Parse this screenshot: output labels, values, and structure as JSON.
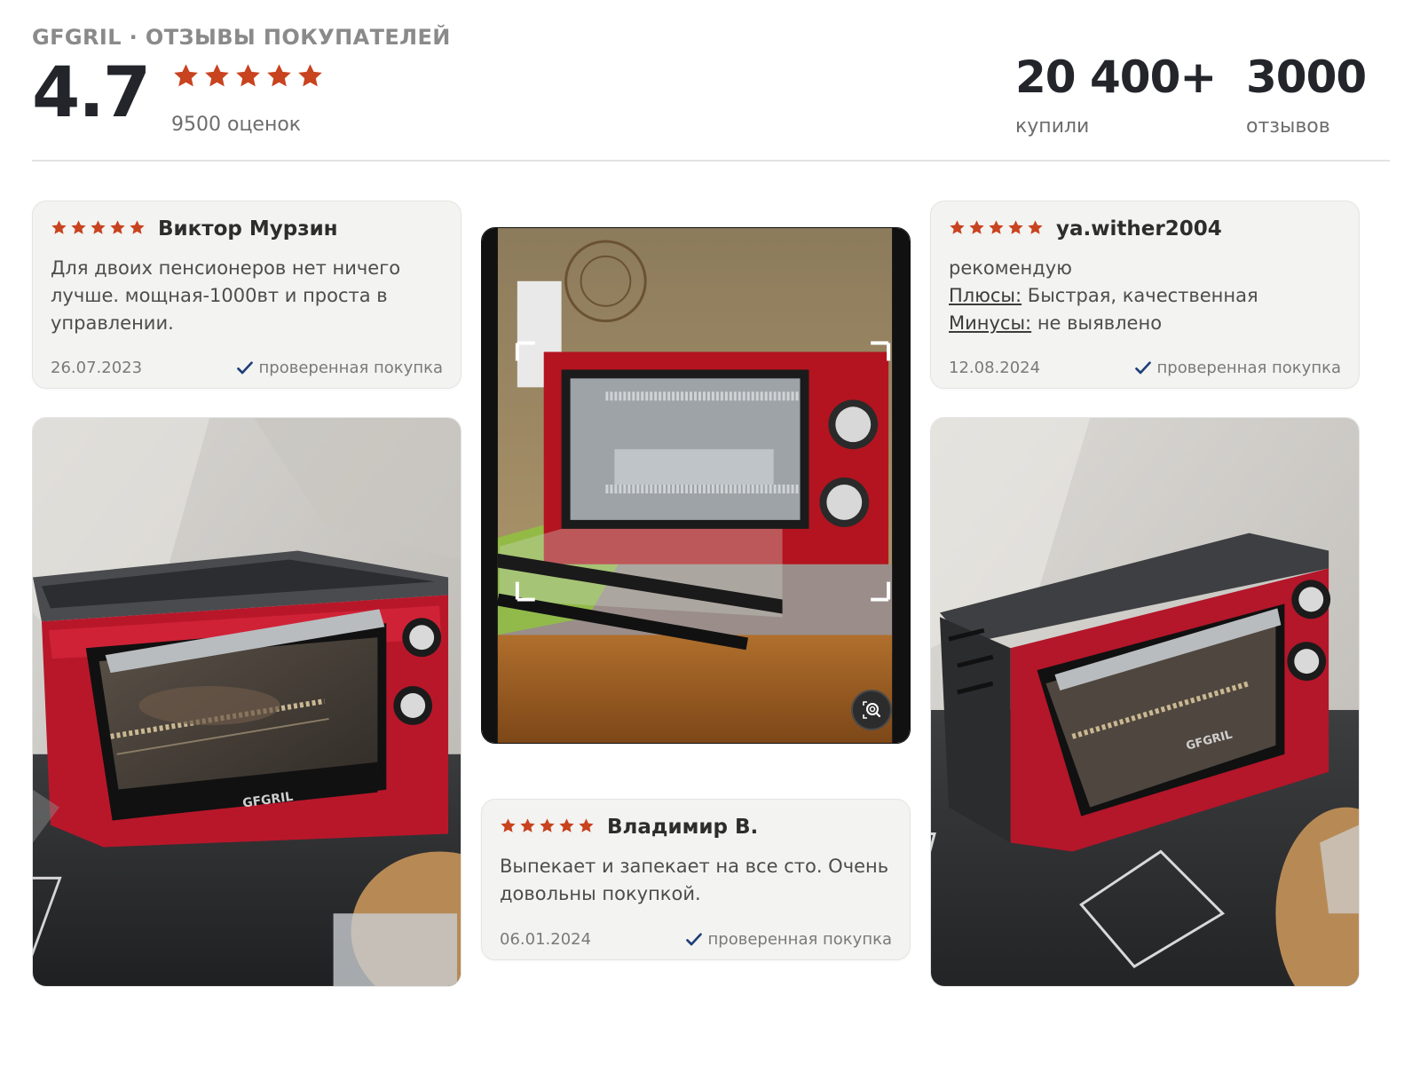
{
  "header": {
    "brand_title": "GFGRIL · ОТЗЫВЫ ПОКУПАТЕЛЕЙ",
    "rating": "4.7",
    "stars": 5,
    "rating_count": "9500 оценок",
    "bought_value": "20 400+",
    "bought_label": "купили",
    "reviews_value": "3000",
    "reviews_label": "отзывов"
  },
  "colors": {
    "star": "#c8431f",
    "check": "#1f3e78",
    "oven_red": "#c0182b"
  },
  "reviews": [
    {
      "stars": 5,
      "author": "Виктор Мурзин",
      "text": "Для двоих пенсионеров нет ничего лучше. мощная-1000вт и проста в управлении.",
      "date": "26.07.2023",
      "verified": "проверенная покупка"
    },
    {
      "stars": 5,
      "author": "ya.wither2004",
      "text": "рекомендую",
      "pros_label": "Плюсы:",
      "pros": "Быстрая, качественная",
      "cons_label": "Минусы:",
      "cons": "не выявлено",
      "date": "12.08.2024",
      "verified": "проверенная покупка"
    },
    {
      "stars": 5,
      "author": "Владимир В.",
      "text": "Выпекает и запекает на все сто. Очень довольны покупкой.",
      "date": "06.01.2024",
      "verified": "проверенная покупка"
    }
  ],
  "photos": {
    "brand_on_oven": "GFGRIL",
    "zoom_icon": "search-zoom-icon"
  }
}
